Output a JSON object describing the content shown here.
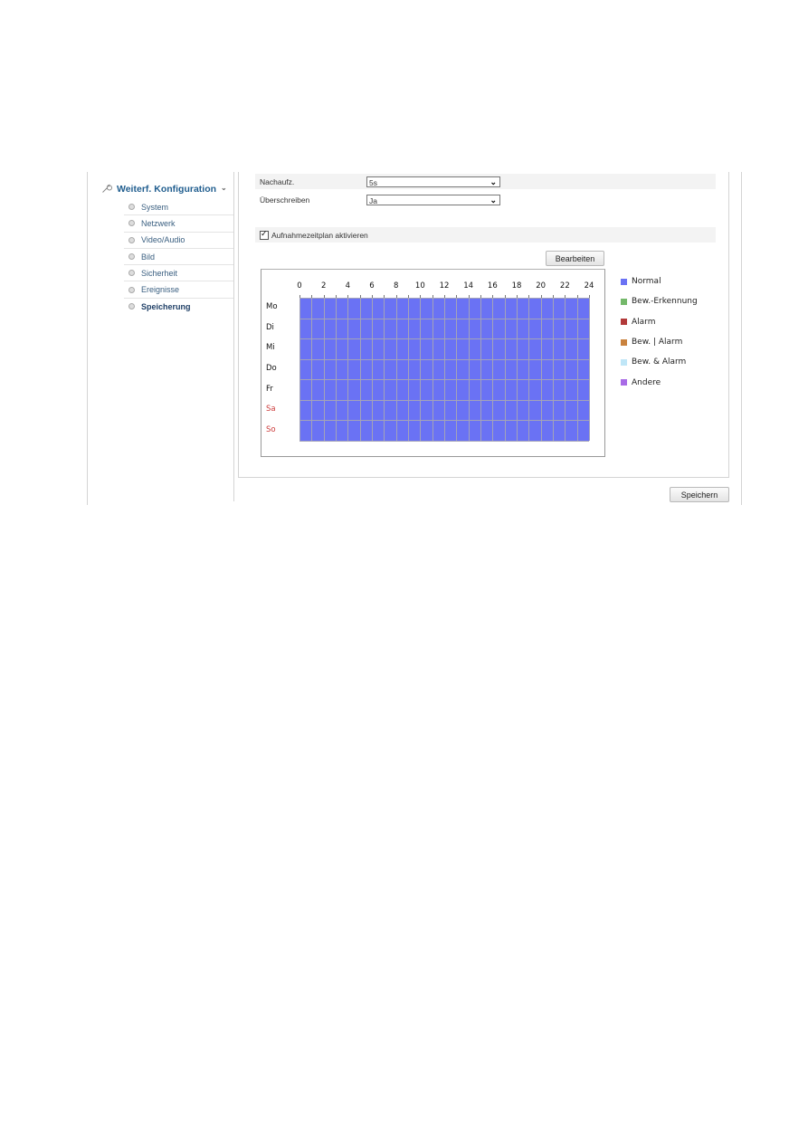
{
  "sidebar": {
    "section_title": "Weiterf. Konfiguration",
    "section_icon": "wrench-icon",
    "items": [
      {
        "label": "System",
        "active": false
      },
      {
        "label": "Netzwerk",
        "active": false
      },
      {
        "label": "Video/Audio",
        "active": false
      },
      {
        "label": "Bild",
        "active": false
      },
      {
        "label": "Sicherheit",
        "active": false
      },
      {
        "label": "Ereignisse",
        "active": false
      },
      {
        "label": "Speicherung",
        "active": true
      }
    ]
  },
  "form": {
    "post_record": {
      "label": "Nachaufz.",
      "value": "5s"
    },
    "overwrite": {
      "label": "Überschreiben",
      "value": "Ja"
    },
    "schedule_enabled": {
      "label": "Aufnahmezeitplan aktivieren",
      "checked": true
    },
    "edit_button": "Bearbeiten",
    "save_button": "Speichern"
  },
  "schedule": {
    "hour_labels": [
      "0",
      "2",
      "4",
      "6",
      "8",
      "10",
      "12",
      "14",
      "16",
      "18",
      "20",
      "22",
      "24"
    ],
    "days": [
      {
        "label": "Mo",
        "weekend": false,
        "type": "Normal",
        "start": 0,
        "end": 24
      },
      {
        "label": "Di",
        "weekend": false,
        "type": "Normal",
        "start": 0,
        "end": 24
      },
      {
        "label": "Mi",
        "weekend": false,
        "type": "Normal",
        "start": 0,
        "end": 24
      },
      {
        "label": "Do",
        "weekend": false,
        "type": "Normal",
        "start": 0,
        "end": 24
      },
      {
        "label": "Fr",
        "weekend": false,
        "type": "Normal",
        "start": 0,
        "end": 24
      },
      {
        "label": "Sa",
        "weekend": true,
        "type": "Normal",
        "start": 0,
        "end": 24
      },
      {
        "label": "So",
        "weekend": true,
        "type": "Normal",
        "start": 0,
        "end": 24
      }
    ],
    "legend": [
      {
        "label": "Normal",
        "color": "#6a72f4"
      },
      {
        "label": "Bew.-Erkennung",
        "color": "#74b86a"
      },
      {
        "label": "Alarm",
        "color": "#b23a3a"
      },
      {
        "label": "Bew. | Alarm",
        "color": "#c9823e"
      },
      {
        "label": "Bew. & Alarm",
        "color": "#bfe6f7"
      },
      {
        "label": "Andere",
        "color": "#a86be6"
      }
    ]
  }
}
